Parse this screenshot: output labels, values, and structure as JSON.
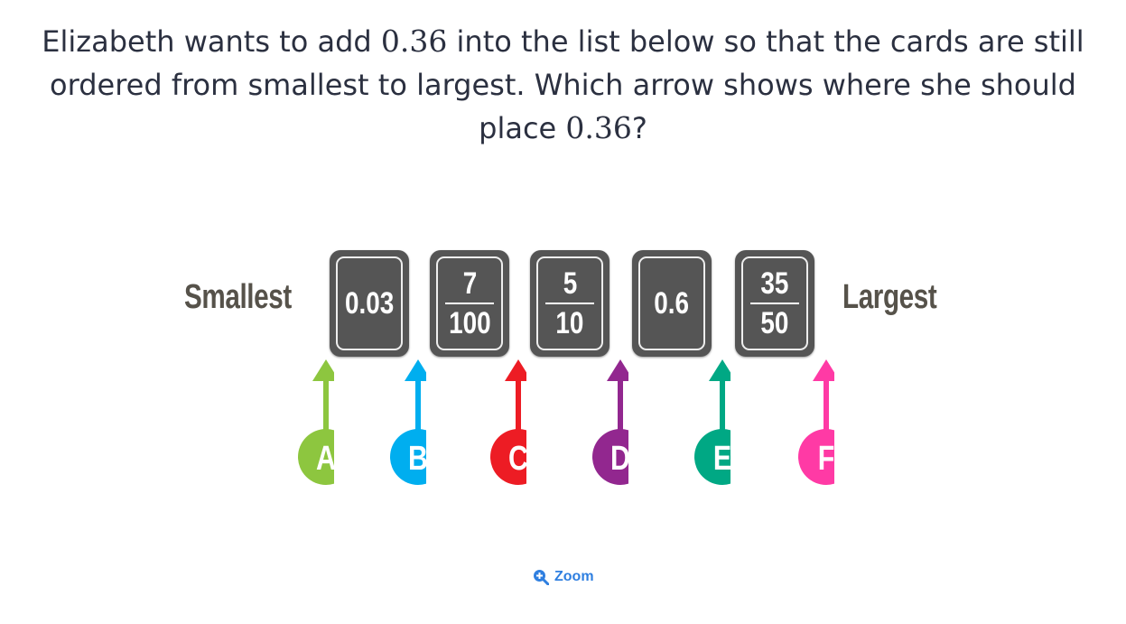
{
  "question": {
    "line1_a": "Elizabeth wants to add ",
    "value": "0.36",
    "line1_b": " into the list below so that the cards are still",
    "line2": "ordered from smallest to largest. Which arrow shows where she should",
    "line3_a": "place ",
    "line3_b": "?"
  },
  "labels": {
    "smallest": "Smallest",
    "largest": "Largest"
  },
  "cards": [
    {
      "type": "decimal",
      "text": "0.03"
    },
    {
      "type": "fraction",
      "num": "7",
      "den": "100"
    },
    {
      "type": "fraction",
      "num": "5",
      "den": "10"
    },
    {
      "type": "decimal",
      "text": "0.6"
    },
    {
      "type": "fraction",
      "num": "35",
      "den": "50"
    }
  ],
  "arrows": [
    {
      "letter": "A",
      "color": "#8dc63f"
    },
    {
      "letter": "B",
      "color": "#00aeef"
    },
    {
      "letter": "C",
      "color": "#ed1c24"
    },
    {
      "letter": "D",
      "color": "#92278f"
    },
    {
      "letter": "E",
      "color": "#00a884"
    },
    {
      "letter": "F",
      "color": "#ff3aa5"
    }
  ],
  "zoom": {
    "label": "Zoom",
    "icon": "zoom-in-icon",
    "color": "#2f7fe0"
  }
}
